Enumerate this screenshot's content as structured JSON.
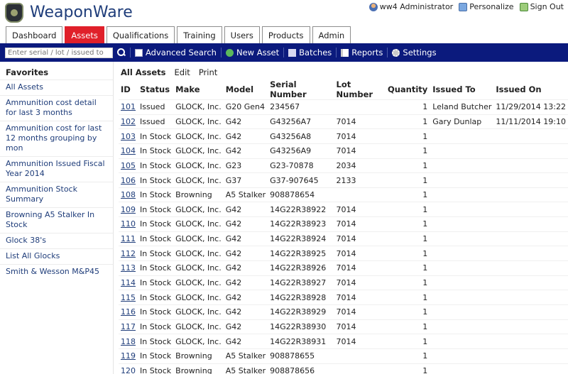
{
  "app": {
    "title": "WeaponWare"
  },
  "user_links": {
    "user": "ww4 Administrator",
    "personalize": "Personalize",
    "signout": "Sign Out"
  },
  "tabs": [
    "Dashboard",
    "Assets",
    "Qualifications",
    "Training",
    "Users",
    "Products",
    "Admin"
  ],
  "active_tab": "Assets",
  "toolbar": {
    "search_placeholder": "Enter serial / lot / issued to",
    "advanced_search": "Advanced Search",
    "new_asset": "New Asset",
    "batches": "Batches",
    "reports": "Reports",
    "settings": "Settings"
  },
  "favorites": {
    "title": "Favorites",
    "items": [
      "All Assets",
      "Ammunition cost detail for last 3 months",
      "Ammunition cost for last 12 months grouping by mon",
      "Ammunition Issued Fiscal Year 2014",
      "Ammunition Stock Summary",
      "Browning A5 Stalker In Stock",
      "Glock 38's",
      "List All Glocks",
      "Smith & Wesson M&P45"
    ]
  },
  "actions": {
    "all_assets": "All Assets",
    "edit": "Edit",
    "print": "Print"
  },
  "table": {
    "columns": [
      "ID",
      "Status",
      "Make",
      "Model",
      "Serial Number",
      "Lot Number",
      "Quantity",
      "Issued To",
      "Issued On"
    ],
    "rows": [
      [
        "101",
        "Issued",
        "GLOCK, Inc.",
        "G20 Gen4",
        "234567",
        "",
        "1",
        "Leland Butcher",
        "11/29/2014 13:22"
      ],
      [
        "102",
        "Issued",
        "GLOCK, Inc.",
        "G42",
        "G43256A7",
        "7014",
        "1",
        "Gary Dunlap",
        "11/11/2014 19:10"
      ],
      [
        "103",
        "In Stock",
        "GLOCK, Inc.",
        "G42",
        "G43256A8",
        "7014",
        "1",
        "",
        ""
      ],
      [
        "104",
        "In Stock",
        "GLOCK, Inc.",
        "G42",
        "G43256A9",
        "7014",
        "1",
        "",
        ""
      ],
      [
        "105",
        "In Stock",
        "GLOCK, Inc.",
        "G23",
        "G23-70878",
        "2034",
        "1",
        "",
        ""
      ],
      [
        "106",
        "In Stock",
        "GLOCK, Inc.",
        "G37",
        "G37-907645",
        "2133",
        "1",
        "",
        ""
      ],
      [
        "108",
        "In Stock",
        "Browning",
        "A5 Stalker",
        "908878654",
        "",
        "1",
        "",
        ""
      ],
      [
        "109",
        "In Stock",
        "GLOCK, Inc.",
        "G42",
        "14G22R38922",
        "7014",
        "1",
        "",
        ""
      ],
      [
        "110",
        "In Stock",
        "GLOCK, Inc.",
        "G42",
        "14G22R38923",
        "7014",
        "1",
        "",
        ""
      ],
      [
        "111",
        "In Stock",
        "GLOCK, Inc.",
        "G42",
        "14G22R38924",
        "7014",
        "1",
        "",
        ""
      ],
      [
        "112",
        "In Stock",
        "GLOCK, Inc.",
        "G42",
        "14G22R38925",
        "7014",
        "1",
        "",
        ""
      ],
      [
        "113",
        "In Stock",
        "GLOCK, Inc.",
        "G42",
        "14G22R38926",
        "7014",
        "1",
        "",
        ""
      ],
      [
        "114",
        "In Stock",
        "GLOCK, Inc.",
        "G42",
        "14G22R38927",
        "7014",
        "1",
        "",
        ""
      ],
      [
        "115",
        "In Stock",
        "GLOCK, Inc.",
        "G42",
        "14G22R38928",
        "7014",
        "1",
        "",
        ""
      ],
      [
        "116",
        "In Stock",
        "GLOCK, Inc.",
        "G42",
        "14G22R38929",
        "7014",
        "1",
        "",
        ""
      ],
      [
        "117",
        "In Stock",
        "GLOCK, Inc.",
        "G42",
        "14G22R38930",
        "7014",
        "1",
        "",
        ""
      ],
      [
        "118",
        "In Stock",
        "GLOCK, Inc.",
        "G42",
        "14G22R38931",
        "7014",
        "1",
        "",
        ""
      ],
      [
        "119",
        "In Stock",
        "Browning",
        "A5 Stalker",
        "908878655",
        "",
        "1",
        "",
        ""
      ],
      [
        "120",
        "In Stock",
        "Browning",
        "A5 Stalker",
        "908878656",
        "",
        "1",
        "",
        ""
      ]
    ]
  },
  "colors": {
    "toolbar_bg": "#0b1a7d",
    "active_tab": "#e0202a",
    "title": "#1f3d7a"
  }
}
